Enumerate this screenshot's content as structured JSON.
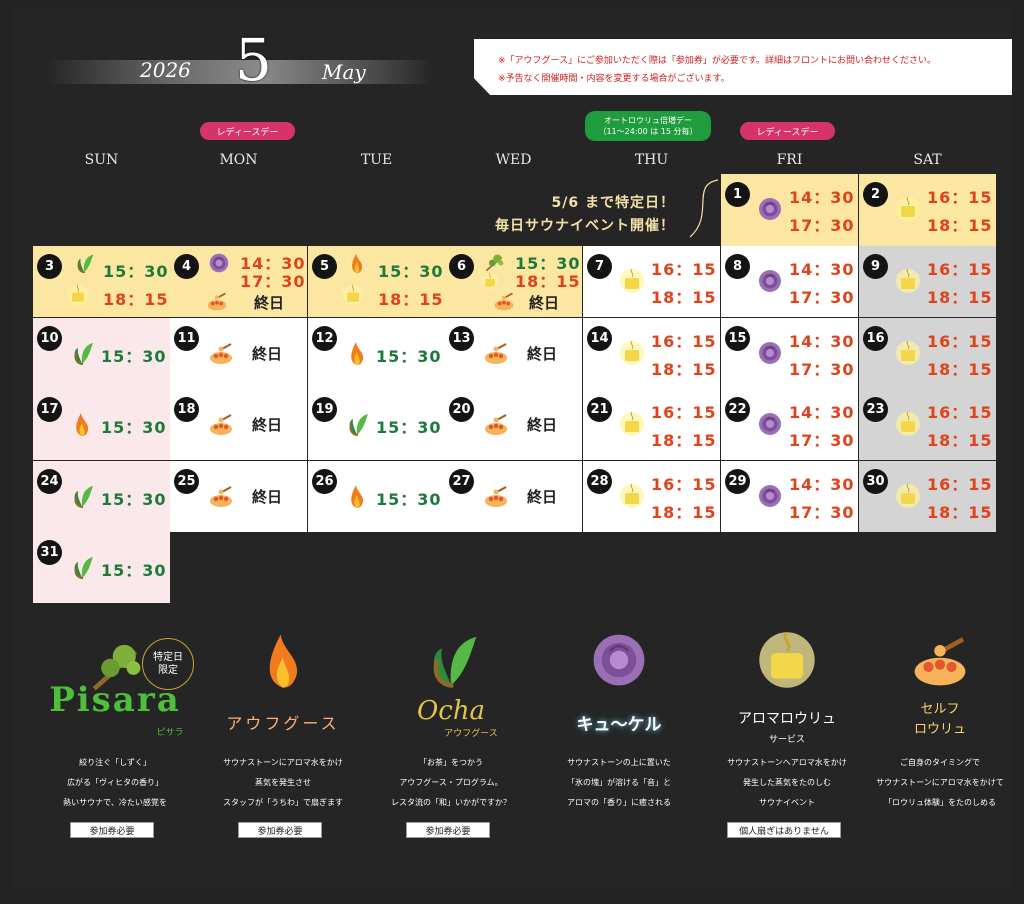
{
  "header": {
    "year": "2026",
    "month": "5",
    "month_name": "May"
  },
  "notice": {
    "line1": "※「アウフグース」にご参加いただく際は「参加券」が必要です。詳細はフロントにお問い合わせください。",
    "line2": "※予告なく開催時間・内容を変更する場合がございます。"
  },
  "labels": {
    "ladies": "レディースデー",
    "autoloyly_title": "オートロウリュ倍増デー",
    "autoloyly_sub": "（11～24:00 は 15 分毎）"
  },
  "weekdays": [
    "SUN",
    "MON",
    "TUE",
    "WED",
    "THU",
    "FRI",
    "SAT"
  ],
  "special": {
    "line1": "5/6 まで特定日！",
    "line2": "毎日サウナイベント開催！"
  },
  "endday": "終日",
  "colors": {
    "yellow": "#fbe7a2",
    "white": "#ffffff",
    "gray": "#d4d4d4",
    "pink": "#fbe8ea",
    "green_text": "#1e7a3a",
    "red_text": "#e0431b",
    "ladies_pill": "#d6336c",
    "green_pill": "#1f9c3d"
  },
  "calendar": [
    {
      "date": "1",
      "icons": [
        "rose-icon"
      ],
      "times": [
        "14：30",
        "17：30"
      ]
    },
    {
      "date": "2",
      "icons": [
        "lamp-icon"
      ],
      "times": [
        "16：15",
        "18：15"
      ]
    },
    {
      "date": "3",
      "icons": [
        "leaf-icon",
        "lamp-icon"
      ],
      "times": [
        "15：30",
        "18：15"
      ]
    },
    {
      "date": "4",
      "icons": [
        "rose-icon",
        "bowl-icon"
      ],
      "times": [
        "14：30",
        "17：30"
      ],
      "allday": true
    },
    {
      "date": "5",
      "icons": [
        "flame-icon",
        "lamp-icon"
      ],
      "times": [
        "15：30",
        "18：15"
      ]
    },
    {
      "date": "6",
      "icons": [
        "birch-icon",
        "lamp-icon",
        "bowl-icon"
      ],
      "times": [
        "15：30",
        "18：15"
      ],
      "allday": true
    },
    {
      "date": "7",
      "icons": [
        "lamp-icon"
      ],
      "times": [
        "16：15",
        "18：15"
      ]
    },
    {
      "date": "8",
      "icons": [
        "rose-icon"
      ],
      "times": [
        "14：30",
        "17：30"
      ]
    },
    {
      "date": "9",
      "icons": [
        "lamp-icon"
      ],
      "times": [
        "16：15",
        "18：15"
      ]
    },
    {
      "date": "10",
      "icons": [
        "leaf-icon"
      ],
      "times": [
        "15：30"
      ]
    },
    {
      "date": "11",
      "icons": [
        "bowl-icon"
      ],
      "allday": true
    },
    {
      "date": "12",
      "icons": [
        "flame-icon"
      ],
      "times": [
        "15：30"
      ]
    },
    {
      "date": "13",
      "icons": [
        "bowl-icon"
      ],
      "allday": true
    },
    {
      "date": "14",
      "icons": [
        "lamp-icon"
      ],
      "times": [
        "16：15",
        "18：15"
      ]
    },
    {
      "date": "15",
      "icons": [
        "rose-icon"
      ],
      "times": [
        "14：30",
        "17：30"
      ]
    },
    {
      "date": "16",
      "icons": [
        "lamp-icon"
      ],
      "times": [
        "16：15",
        "18：15"
      ]
    },
    {
      "date": "17",
      "icons": [
        "flame-icon"
      ],
      "times": [
        "15：30"
      ]
    },
    {
      "date": "18",
      "icons": [
        "bowl-icon"
      ],
      "allday": true
    },
    {
      "date": "19",
      "icons": [
        "leaf-icon"
      ],
      "times": [
        "15：30"
      ]
    },
    {
      "date": "20",
      "icons": [
        "bowl-icon"
      ],
      "allday": true
    },
    {
      "date": "21",
      "icons": [
        "lamp-icon"
      ],
      "times": [
        "16：15",
        "18：15"
      ]
    },
    {
      "date": "22",
      "icons": [
        "rose-icon"
      ],
      "times": [
        "14：30",
        "17：30"
      ]
    },
    {
      "date": "23",
      "icons": [
        "lamp-icon"
      ],
      "times": [
        "16：15",
        "18：15"
      ]
    },
    {
      "date": "24",
      "icons": [
        "leaf-icon"
      ],
      "times": [
        "15：30"
      ]
    },
    {
      "date": "25",
      "icons": [
        "bowl-icon"
      ],
      "allday": true
    },
    {
      "date": "26",
      "icons": [
        "flame-icon"
      ],
      "times": [
        "15：30"
      ]
    },
    {
      "date": "27",
      "icons": [
        "bowl-icon"
      ],
      "allday": true
    },
    {
      "date": "28",
      "icons": [
        "lamp-icon"
      ],
      "times": [
        "16：15",
        "18：15"
      ]
    },
    {
      "date": "29",
      "icons": [
        "rose-icon"
      ],
      "times": [
        "14：30",
        "17：30"
      ]
    },
    {
      "date": "30",
      "icons": [
        "lamp-icon"
      ],
      "times": [
        "16：15",
        "18：15"
      ]
    },
    {
      "date": "31",
      "icons": [
        "leaf-icon"
      ],
      "times": [
        "15：30"
      ]
    }
  ],
  "features": [
    {
      "title": "Pisara",
      "subtitle": "ピサラ",
      "badge_line1": "特定日",
      "badge_line2": "限定",
      "icon": "birch-icon",
      "desc": [
        "絞り注ぐ「しずく」",
        "広がる「ヴィヒタの香り」",
        "熱いサウナで、冷たい感覚を"
      ],
      "button": "参加券必要"
    },
    {
      "title": "アウフグース",
      "icon": "flame-icon",
      "desc": [
        "サウナストーンにアロマ水をかけ",
        "蒸気を発生させ",
        "スタッフが「うちわ」で扇ぎます"
      ],
      "button": "参加券必要"
    },
    {
      "title": "Ocha",
      "subtitle": "アウフグース",
      "icon": "leaf-icon",
      "desc": [
        "「お茶」をつかう",
        "アウフグース・プログラム。",
        "レスタ流の「和」いかがですか？"
      ],
      "button": "参加券必要"
    },
    {
      "title": "キュ〜ケル",
      "icon": "rose-icon",
      "desc": [
        "サウナストーンの上に置いた",
        "「氷の塊」が溶ける「音」と",
        "アロマの「香り」に癒される"
      ]
    },
    {
      "title": "アロマロウリュ",
      "subtitle": "サービス",
      "icon": "lamp-icon",
      "desc": [
        "サウナストーンへアロマ水をかけ",
        "発生した蒸気をたのしむ",
        "サウナイベント"
      ],
      "button": "個人扇ぎはありません"
    },
    {
      "title": "セルフ",
      "subtitle": "ロウリュ",
      "icon": "bowl-icon",
      "desc": [
        "ご自身のタイミングで",
        "サウナストーンにアロマ水をかけて",
        "「ロウリュ体験」をたのしめる"
      ]
    }
  ]
}
